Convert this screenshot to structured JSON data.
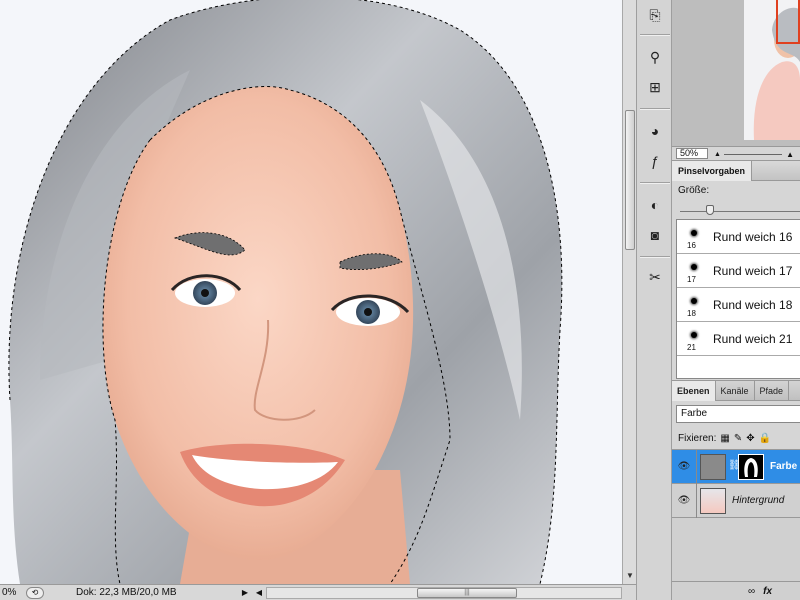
{
  "canvas": {
    "subject": "woman-with-gray-hair"
  },
  "statusbar": {
    "zoom": "0%",
    "doc_info": "Dok: 22,3 MB/20,0 MB"
  },
  "dock": {
    "icons": [
      "history-icon",
      "brush-tool-icon",
      "clone-source-icon",
      "styles-icon",
      "fx-icon",
      "adjustments-icon",
      "masks-icon",
      "tools-icon"
    ]
  },
  "navigator": {
    "zoom": "50%"
  },
  "brushes": {
    "tab": "Pinselvorgaben",
    "size_label": "Größe:",
    "presets": [
      {
        "size": "16",
        "name": "Rund weich 16"
      },
      {
        "size": "17",
        "name": "Rund weich 17"
      },
      {
        "size": "18",
        "name": "Rund weich 18"
      },
      {
        "size": "21",
        "name": "Rund weich 21"
      }
    ]
  },
  "layers": {
    "tabs": [
      "Ebenen",
      "Kanäle",
      "Pfade"
    ],
    "blend_mode": "Farbe",
    "lock_label": "Fixieren:",
    "items": [
      {
        "name": "Farbe",
        "selected": true
      },
      {
        "name": "Hintergrund",
        "selected": false
      }
    ],
    "footer": [
      "link-icon",
      "fx"
    ]
  },
  "colors": {
    "selection_blue": "#2f8de6",
    "navigator_frame": "#e0401f",
    "canvas_bg": "#f4f6fa"
  }
}
